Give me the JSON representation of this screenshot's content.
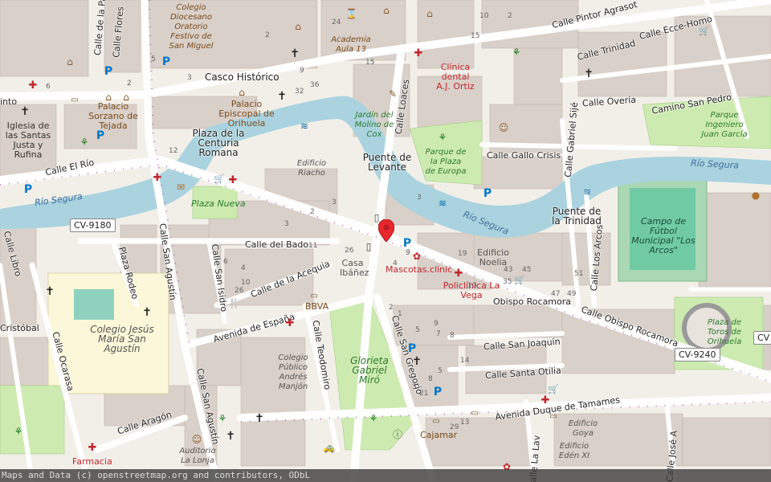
{
  "map": {
    "attribution": "Maps and Data (c) openstreetmap.org and contributors, ODbL",
    "colors": {
      "background": "#f2efe9",
      "water": "#aad3df",
      "park": "#cdebb0",
      "building": "#d9d0c9",
      "road": "#ffffff",
      "marker": "#e8262b"
    },
    "marker": {
      "icon": "map-pin-icon",
      "color": "#e8262b"
    },
    "streets": {
      "pintor_agrasot": "Calle Pintor Agrasot",
      "ecce_homo": "Calle Ecce-Homo",
      "trinidad": "Calle Trinidad",
      "overia": "Calle Overía",
      "camino_san_pedro": "Camino San Pedro",
      "loaces": "Calle Loaces",
      "gallo_crisis": "Calle Gallo Crisis",
      "gabriel_sije": "Calle Gabriel Sijé",
      "el_rio": "Calle El Río",
      "del_bado": "Calle del Bado",
      "de_la_acequia": "Calle de la Acequia",
      "san_agustin": "Calle San Agustín",
      "san_isidro": "Calle San Isidro",
      "plaza_rodeo": "Plaza Rodeo",
      "avenida_espana": "Avenida de España",
      "teodomiro": "Calle Teodomiro",
      "san_gregorio": "Calle San Gregorio",
      "san_joaquin": "Calle San Joaquín",
      "santa_otilia": "Calle Santa Otilia",
      "duque_tamames": "Avenida Duque de Tamames",
      "obispo_rocamora": "Calle Obispo Rocamora",
      "obispo_rocamora_short": "Obispo Rocamora",
      "los_arcos": "Calle Los Arcos",
      "aragon": "Calle Aragón",
      "ocarasa": "Calle Ocarasa",
      "cristobal": "Cristóbal",
      "libro": "Calle Libro",
      "flores": "Calle Flores",
      "de_la_pa": "Calle de la Pa",
      "la_lav": "Calle La Lav",
      "jose_a": "Calle José A",
      "san_agustin_south": "Calle San Agustín"
    },
    "shields": {
      "cv9180": "CV-9180",
      "cv9240": "CV-9240",
      "cv_edge": "CV"
    },
    "water": {
      "rio_segura_w": "Río Segura",
      "rio_segura_c": "Río Segura",
      "rio_segura_e": "Río Segura"
    },
    "places": {
      "casco_historico": "Casco Histórico",
      "plaza_centuria": "Plaza de la Centuria Romana",
      "puente_levante": "Puente de Levante",
      "puente_trinidad": "Puente de la Trinidad",
      "casa_ibanez": "Casa Ibáñez",
      "edificio_noelia": "Edificio Noelia",
      "palacio_sorzano": "Palacio Sorzano de Tejada",
      "palacio_episcopal": "Palacio Episcopal de Orihuela",
      "iglesia_santas": "Iglesia de las Santas Justa y Rufina",
      "colegio_jesus": "Colegio Jesús María San Agustín",
      "colegio_publico": "Colegio Público Andrés Manjón",
      "auditorio": "Auditorio La Lonja",
      "farmacia": "Farmacia",
      "cajamar": "Cajamar",
      "bbva": "BBVA",
      "edificio_riacho": "Edificio Riacho",
      "edificio_goya": "Edificio Goya",
      "edificio_eden": "Edificio Edén XI",
      "colegio_diocesano": "Colegio Diocesano Oratorio Festivo de San Miguel",
      "academia": "Academia Aula 13",
      "into": "into"
    },
    "parks": {
      "jardin_molino": "Jardín del Molino de Cox",
      "parque_plaza_europa": "Parque de la Plaza de Europa",
      "plaza_nueva": "Plaza Nueva",
      "glorieta": "Glorieta Gabriel Miró",
      "parque_ingeniero": "Parque Ingeniero Juan García",
      "campo_futbol": "Campo de Fútbol Municipal \"Los Arcos\"",
      "plaza_toros": "Plaza de Toros de Orihuela"
    },
    "pois": {
      "clinica_dental": "Clínica dental A.J. Ortiz",
      "mascotas": "Mascotas.clinic",
      "policlinica": "Policlínica La Vega"
    },
    "house_numbers": [
      "24",
      "2",
      "5",
      "2",
      "32",
      "9",
      "26",
      "36",
      "6",
      "3",
      "15",
      "19",
      "43",
      "45",
      "47",
      "49",
      "51",
      "35",
      "5",
      "7",
      "9",
      "10",
      "2",
      "4",
      "3",
      "10",
      "29",
      "21",
      "13",
      "14",
      "9",
      "8",
      "3",
      "1",
      "2",
      "8",
      "11",
      "6",
      "4",
      "10",
      "3",
      "3",
      "2",
      "12",
      "26",
      "15",
      "5"
    ]
  }
}
